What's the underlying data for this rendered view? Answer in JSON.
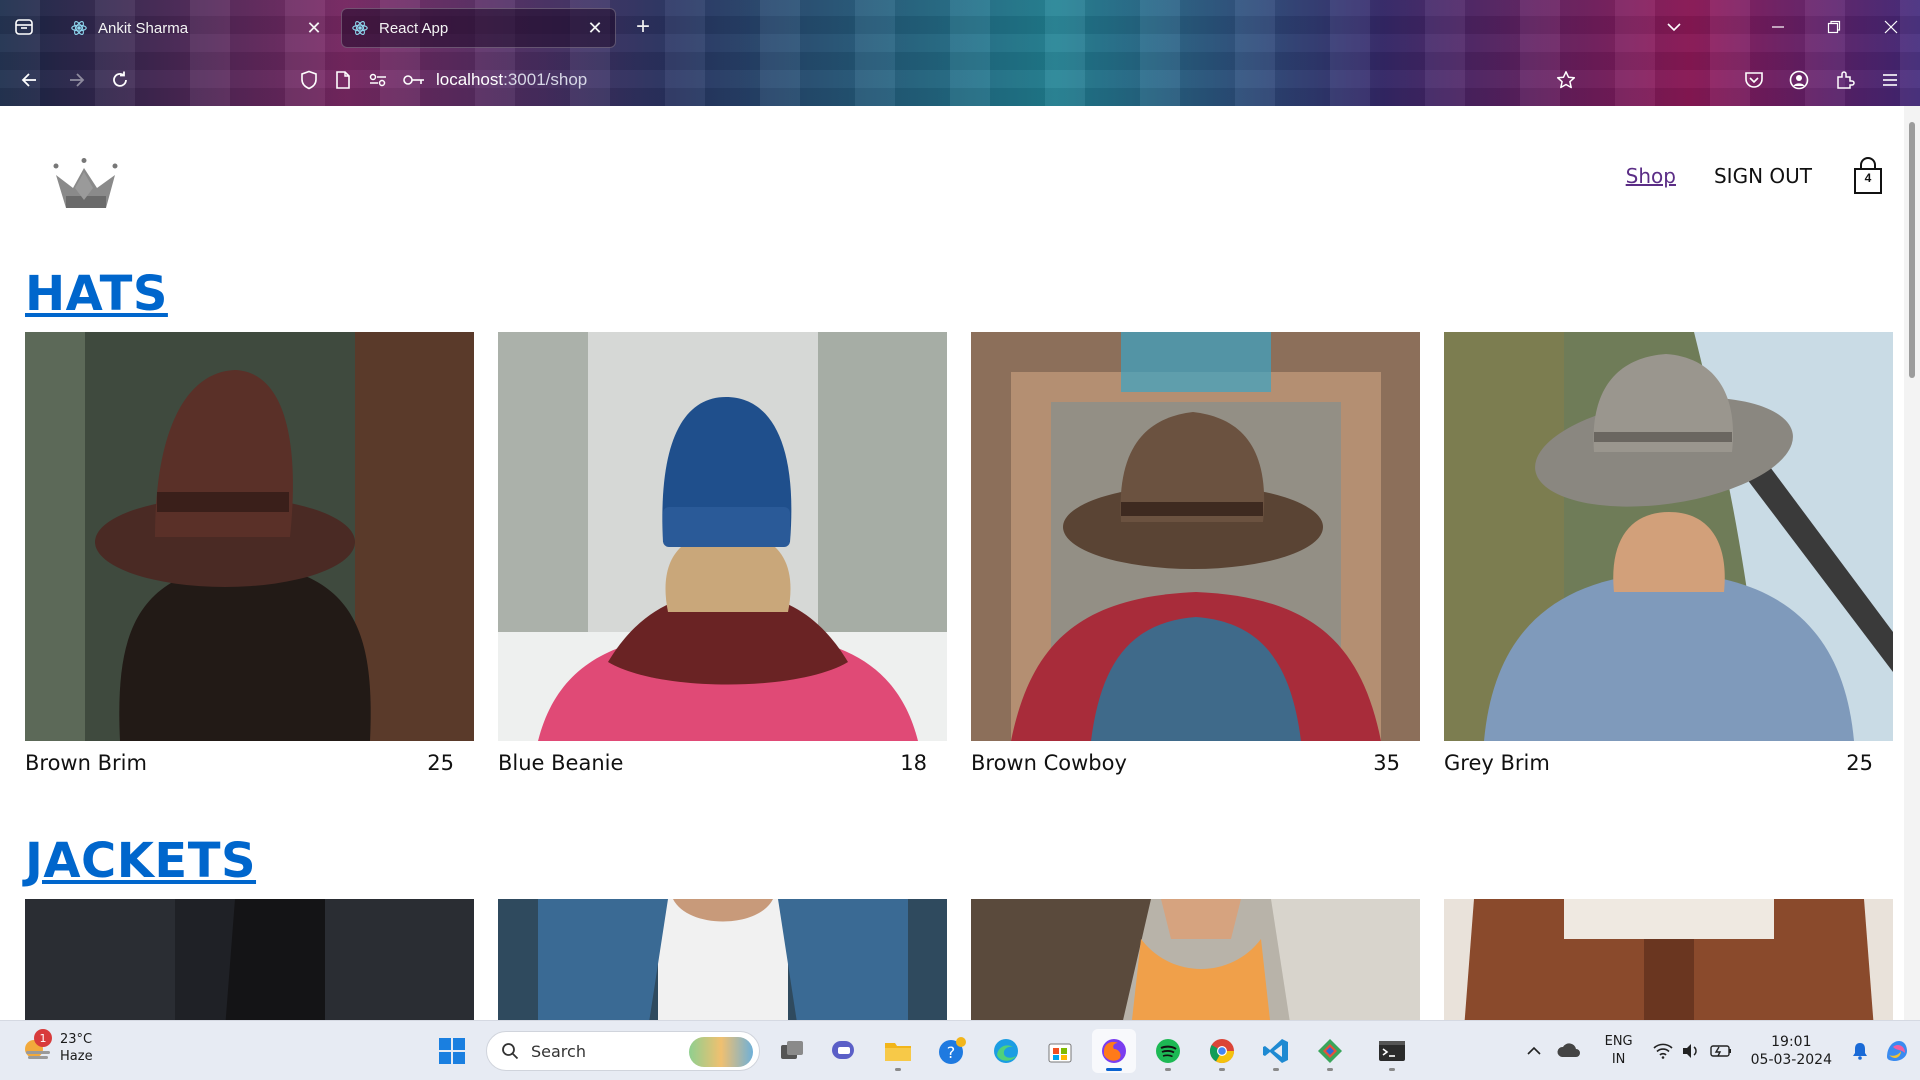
{
  "browser": {
    "tabs": [
      {
        "title": "Ankit Sharma",
        "active": false
      },
      {
        "title": "React App",
        "active": true
      }
    ],
    "url_host": "localhost",
    "url_rest": ":3001/shop"
  },
  "header": {
    "nav": {
      "shop": "Shop",
      "sign_out": "SIGN OUT"
    },
    "cart_count": "4"
  },
  "sections": [
    {
      "title": "HATS",
      "items": [
        {
          "name": "Brown Brim",
          "price": "25"
        },
        {
          "name": "Blue Beanie",
          "price": "18"
        },
        {
          "name": "Brown Cowboy",
          "price": "35"
        },
        {
          "name": "Grey Brim",
          "price": "25"
        }
      ]
    },
    {
      "title": "JACKETS",
      "items": [
        {
          "name": "",
          "price": ""
        },
        {
          "name": "",
          "price": ""
        },
        {
          "name": "",
          "price": ""
        },
        {
          "name": "",
          "price": ""
        }
      ]
    }
  ],
  "taskbar": {
    "weather_temp": "23°C",
    "weather_desc": "Haze",
    "weather_badge": "1",
    "search_placeholder": "Search",
    "lang_1": "ENG",
    "lang_2": "IN",
    "time": "19:01",
    "date": "05-03-2024"
  },
  "colors": {
    "link_blue": "#0066cc",
    "shop_link": "#5b2d86",
    "taskbar": "#e7ebf3"
  }
}
